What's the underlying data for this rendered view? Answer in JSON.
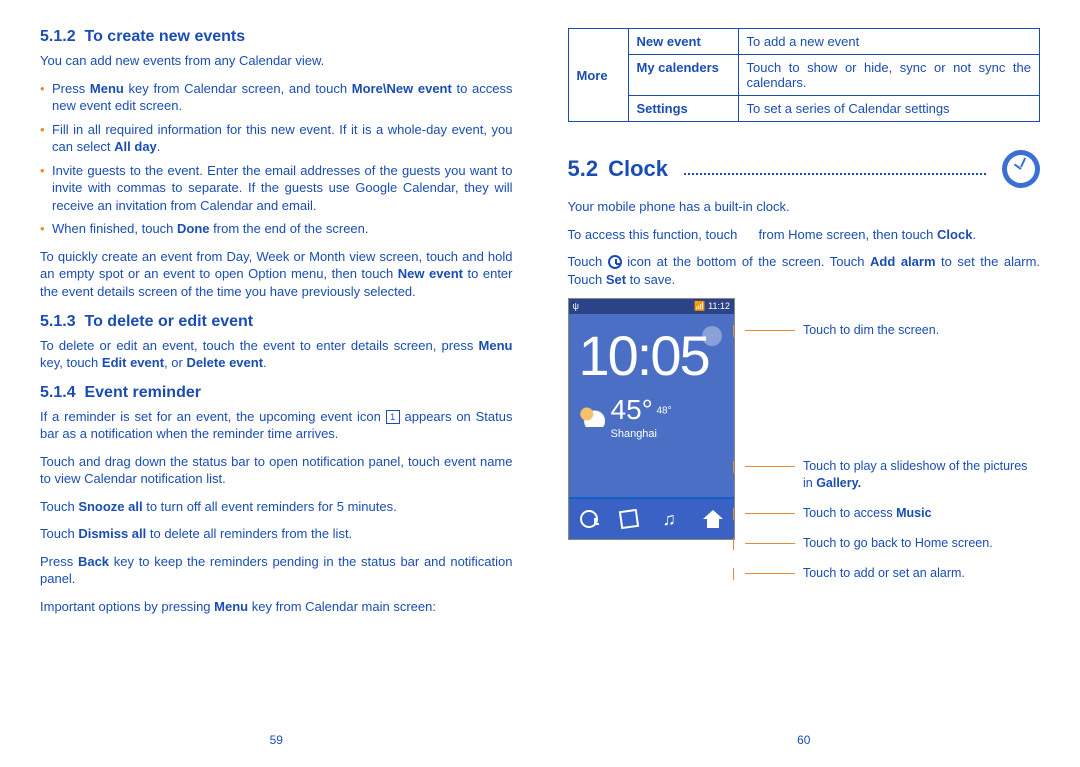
{
  "left": {
    "h512_num": "5.1.2",
    "h512_title": "To create new events",
    "p512_intro": "You can add new events from any Calendar view.",
    "b512": [
      {
        "pre": "Press ",
        "b1": "Menu",
        "mid": " key from Calendar screen, and touch ",
        "b2": "More\\New event",
        "post": " to access new event edit screen."
      },
      {
        "pre": "Fill in all required information for this new event. If it is a whole-day event, you can select ",
        "b1": "All day",
        "post": "."
      },
      {
        "pre": "Invite guests to the event. Enter the email addresses of the guests you want to invite with commas to separate. If the guests use Google Calendar, they will receive an invitation from Calendar and email."
      },
      {
        "pre": "When finished, touch ",
        "b1": "Done",
        "post": " from the end of the screen."
      }
    ],
    "p512_quick_pre": "To quickly create an event from Day, Week or Month view screen, touch and hold an empty spot or an event to open Option menu, then touch ",
    "p512_quick_b": "New event",
    "p512_quick_post": " to enter the event details screen of the time you have previously selected.",
    "h513_num": "5.1.3",
    "h513_title": "To delete or edit event",
    "p513_pre": "To delete or edit an event, touch the event to enter details screen, press ",
    "p513_b1": "Menu",
    "p513_m1": " key, touch ",
    "p513_b2": "Edit event",
    "p513_m2": ", or ",
    "p513_b3": "Delete event",
    "p513_post": ".",
    "h514_num": "5.1.4",
    "h514_title": "Event reminder",
    "p514a_pre": "If a reminder is set for an event, the upcoming event icon ",
    "p514a_post": " appears on Status bar as a notification when the reminder time arrives.",
    "p514b": "Touch and drag down the status bar to open notification panel, touch event name to view Calendar notification list.",
    "p514c_pre": "Touch ",
    "p514c_b": "Snooze all",
    "p514c_post": " to turn off all event reminders for 5 minutes.",
    "p514d_pre": "Touch ",
    "p514d_b": "Dismiss all",
    "p514d_post": " to delete all reminders from the list.",
    "p514e_pre": "Press ",
    "p514e_b": "Back",
    "p514e_post": " key to keep the reminders pending in the status bar and notification panel.",
    "p514f_pre": "Important options by pressing ",
    "p514f_b": "Menu",
    "p514f_post": " key from Calendar main screen:",
    "pagenum": "59"
  },
  "right": {
    "table": {
      "side": "More",
      "rows": [
        {
          "k": "New event",
          "v": "To add a new event"
        },
        {
          "k": "My calenders",
          "v": "Touch to show or hide, sync or not sync the calendars."
        },
        {
          "k": "Settings",
          "v": "To set a series of Calendar settings"
        }
      ]
    },
    "sec_num": "5.2",
    "sec_title": "Clock",
    "p1": "Your mobile phone has a built-in clock.",
    "p2_pre": "To access this function, touch ",
    "p2_post": " from Home screen, then touch ",
    "p2_b": "Clock",
    "p2_end": ".",
    "p3_pre": "Touch ",
    "p3_mid": " icon at the bottom of the screen. Touch ",
    "p3_b1": "Add alarm",
    "p3_mid2": " to set the alarm. Touch ",
    "p3_b2": "Set",
    "p3_post": " to save.",
    "phone": {
      "status_time": "11:12",
      "time": "10:05",
      "temp": "45°",
      "temp_small": "48°",
      "city": "Shanghai"
    },
    "annots": {
      "a1": "Touch to dim the screen.",
      "a2_pre": "Touch to play a slideshow of the pictures in ",
      "a2_b": "Gallery.",
      "a3_pre": "Touch to access ",
      "a3_b": "Music",
      "a4": "Touch to go back to Home screen.",
      "a5": "Touch to add or set an alarm."
    },
    "pagenum": "60"
  }
}
